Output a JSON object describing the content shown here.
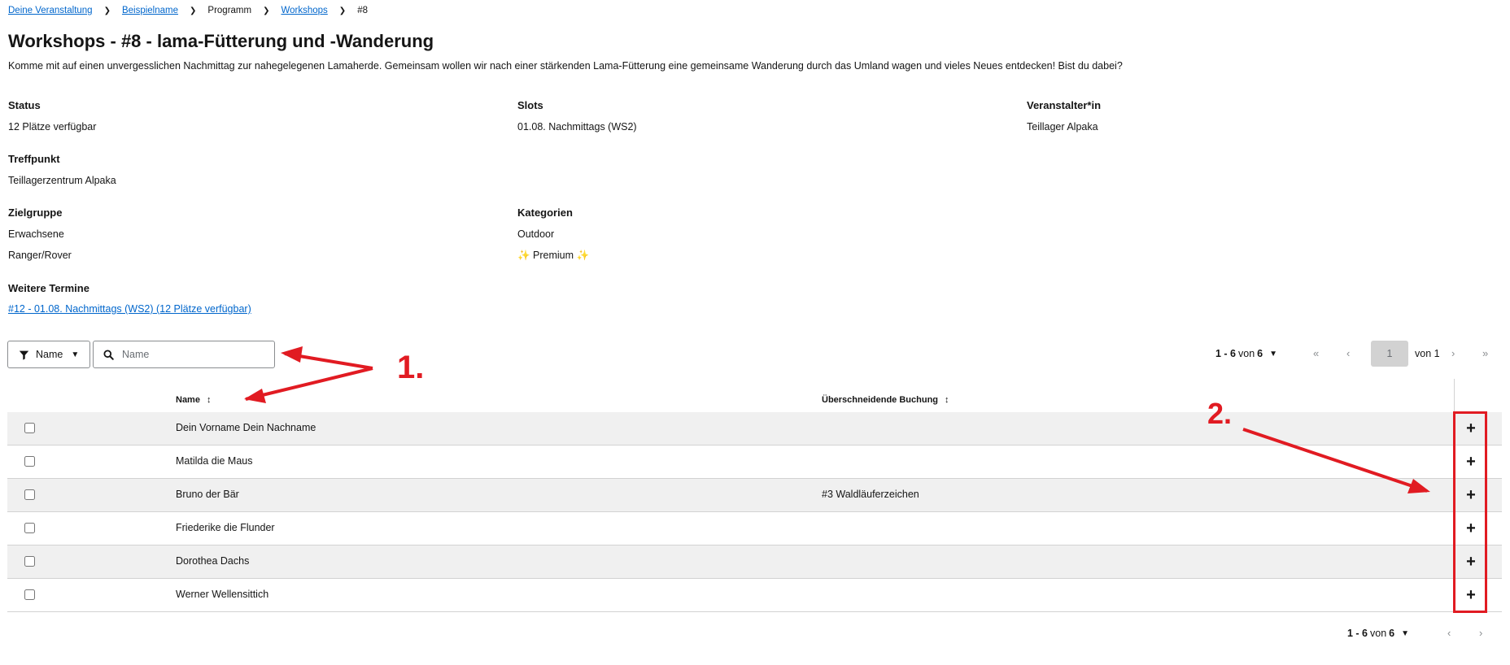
{
  "breadcrumb": {
    "items": [
      {
        "label": "Deine Veranstaltung",
        "link": true
      },
      {
        "label": "Beispielname",
        "link": true
      },
      {
        "label": "Programm",
        "link": false
      },
      {
        "label": "Workshops",
        "link": true
      },
      {
        "label": "#8",
        "link": false
      }
    ]
  },
  "page": {
    "title": "Workshops - #8 - lama-Fütterung und -Wanderung",
    "description": "Komme mit auf einen unvergesslichen Nachmittag zur nahegelegenen Lamaherde. Gemeinsam wollen wir nach einer stärkenden Lama-Fütterung eine gemeinsame Wanderung durch das Umland wagen und vieles Neues entdecken! Bist du dabei?"
  },
  "details": {
    "status": {
      "label": "Status",
      "value": "12 Plätze verfügbar"
    },
    "slots": {
      "label": "Slots",
      "value": "01.08. Nachmittags (WS2)"
    },
    "organizer": {
      "label": "Veranstalter*in",
      "value": "Teillager Alpaka"
    },
    "meeting_point": {
      "label": "Treffpunkt",
      "value": "Teillagerzentrum Alpaka"
    },
    "target_group": {
      "label": "Zielgruppe",
      "values": [
        "Erwachsene",
        "Ranger/Rover"
      ]
    },
    "categories": {
      "label": "Kategorien",
      "values": [
        "Outdoor",
        "✨ Premium ✨"
      ]
    },
    "further_dates": {
      "label": "Weitere Termine",
      "link": "#12 - 01.08. Nachmittags (WS2) (12 Plätze verfügbar)"
    }
  },
  "toolbar": {
    "filter_label": "Name",
    "search_placeholder": "Name",
    "pagination": {
      "range": "1 - 6",
      "of_word": "von",
      "total": "6",
      "current_page": "1",
      "page_total": "von 1"
    }
  },
  "table": {
    "columns": [
      "Name",
      "Überschneidende Buchung"
    ],
    "rows": [
      {
        "name": "Dein Vorname Dein Nachname",
        "overlap": ""
      },
      {
        "name": "Matilda die Maus",
        "overlap": ""
      },
      {
        "name": "Bruno der Bär",
        "overlap": "#3 Waldläuferzeichen"
      },
      {
        "name": "Friederike die Flunder",
        "overlap": ""
      },
      {
        "name": "Dorothea Dachs",
        "overlap": ""
      },
      {
        "name": "Werner Wellensittich",
        "overlap": ""
      }
    ],
    "add_symbol": "+"
  },
  "annotations": {
    "label1": "1.",
    "label2": "2.",
    "color": "#e11b22"
  },
  "colors": {
    "link": "#0066cc",
    "row_alt": "#f0f0f0",
    "border": "#d2d2d2"
  }
}
